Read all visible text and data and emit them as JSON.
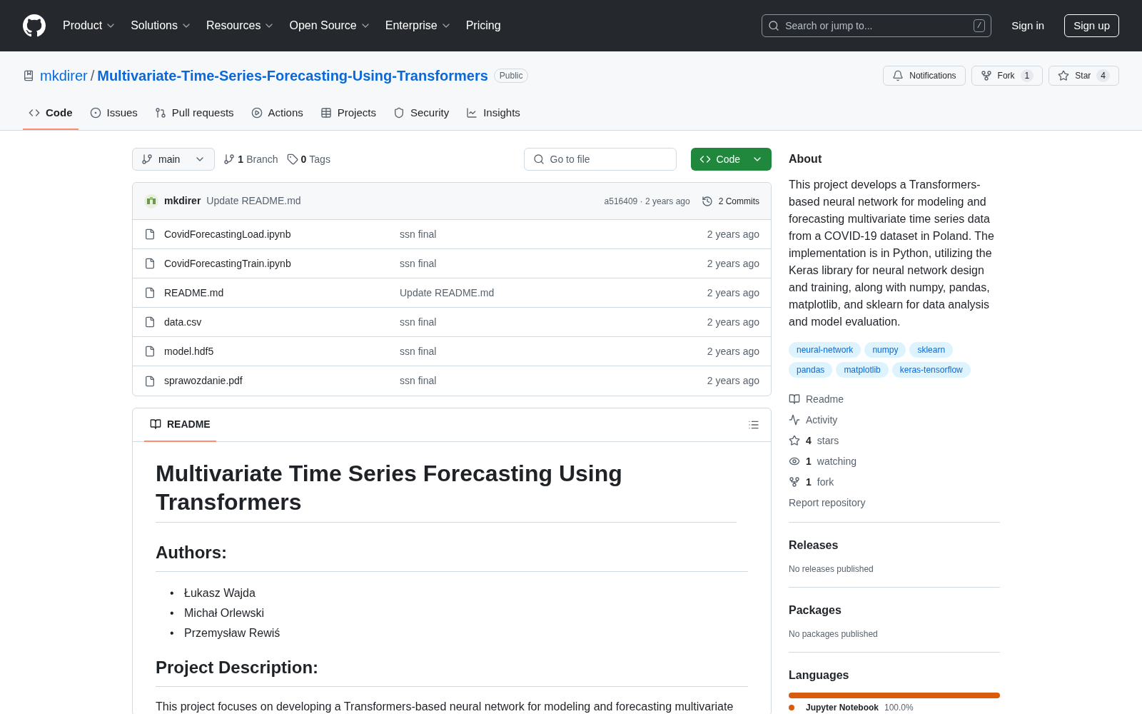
{
  "header": {
    "nav": [
      {
        "label": "Product",
        "dropdown": true
      },
      {
        "label": "Solutions",
        "dropdown": true
      },
      {
        "label": "Resources",
        "dropdown": true
      },
      {
        "label": "Open Source",
        "dropdown": true
      },
      {
        "label": "Enterprise",
        "dropdown": true
      },
      {
        "label": "Pricing",
        "dropdown": false
      }
    ],
    "search": {
      "placeholder": "Search or jump to...",
      "shortcut": "/"
    },
    "sign_in": "Sign in",
    "sign_up": "Sign up"
  },
  "repo": {
    "owner": "mkdirer",
    "separator": "/",
    "name": "Multivariate-Time-Series-Forecasting-Using-Transformers",
    "visibility": "Public",
    "actions": [
      {
        "kind": "notifications",
        "label": "Notifications"
      },
      {
        "kind": "fork",
        "label": "Fork",
        "count": "1"
      },
      {
        "kind": "star",
        "label": "Star",
        "count": "4"
      }
    ],
    "tabs": [
      {
        "kind": "code",
        "label": "Code",
        "selected": true
      },
      {
        "kind": "issues",
        "label": "Issues",
        "selected": false
      },
      {
        "kind": "pulls",
        "label": "Pull requests",
        "selected": false
      },
      {
        "kind": "actions",
        "label": "Actions",
        "selected": false
      },
      {
        "kind": "projects",
        "label": "Projects",
        "selected": false
      },
      {
        "kind": "security",
        "label": "Security",
        "selected": false
      },
      {
        "kind": "insights",
        "label": "Insights",
        "selected": false
      }
    ]
  },
  "toolbar": {
    "branch": "main",
    "branches_count": "1",
    "branches_label": "Branch",
    "tags_count": "0",
    "tags_label": "Tags",
    "go_to_file": "Go to file",
    "code_button": "Code"
  },
  "commit": {
    "author": "mkdirer",
    "message": "Update README.md",
    "hash": "a516409 · 2 years ago",
    "commits": "2 Commits"
  },
  "files": [
    {
      "name": "CovidForecastingLoad.ipynb",
      "message": "ssn final",
      "time": "2 years ago"
    },
    {
      "name": "CovidForecastingTrain.ipynb",
      "message": "ssn final",
      "time": "2 years ago"
    },
    {
      "name": "README.md",
      "message": "Update README.md",
      "time": "2 years ago"
    },
    {
      "name": "data.csv",
      "message": "ssn final",
      "time": "2 years ago"
    },
    {
      "name": "model.hdf5",
      "message": "ssn final",
      "time": "2 years ago"
    },
    {
      "name": "sprawozdanie.pdf",
      "message": "ssn final",
      "time": "2 years ago"
    }
  ],
  "readme": {
    "tab": "README",
    "title": "Multivariate Time Series Forecasting Using Transformers",
    "authors_heading": "Authors:",
    "bullet": "•",
    "authors": [
      "Łukasz Wajda",
      "Michał Orlewski",
      "Przemysław Rewiś"
    ],
    "description_heading": "Project Description:",
    "description": "This project focuses on developing a Transformers-based neural network for modeling and forecasting multivariate"
  },
  "about": {
    "heading": "About",
    "description": "This project develops a Transformers-based neural network for modeling and forecasting multivariate time series data from a COVID-19 dataset in Poland. The implementation is in Python, utilizing the Keras library for neural network design and training, along with numpy, pandas, matplotlib, and sklearn for data analysis and model evaluation.",
    "topics": [
      "neural-network",
      "numpy",
      "sklearn",
      "pandas",
      "matplotlib",
      "keras-tensorflow"
    ],
    "links": [
      {
        "kind": "readme",
        "label": "Readme"
      },
      {
        "kind": "activity",
        "label": "Activity"
      },
      {
        "kind": "stars",
        "count": "4",
        "label": "stars"
      },
      {
        "kind": "watching",
        "count": "1",
        "label": "watching"
      },
      {
        "kind": "fork",
        "count": "1",
        "label": "fork"
      },
      {
        "kind": "report",
        "label": "Report repository"
      }
    ]
  },
  "releases": {
    "heading": "Releases",
    "empty": "No releases published"
  },
  "packages": {
    "heading": "Packages",
    "empty": "No packages published"
  },
  "languages": {
    "heading": "Languages",
    "items": [
      {
        "name": "Jupyter Notebook",
        "percent": "100.0%",
        "color": "#da5b0b",
        "level": 1
      }
    ]
  }
}
